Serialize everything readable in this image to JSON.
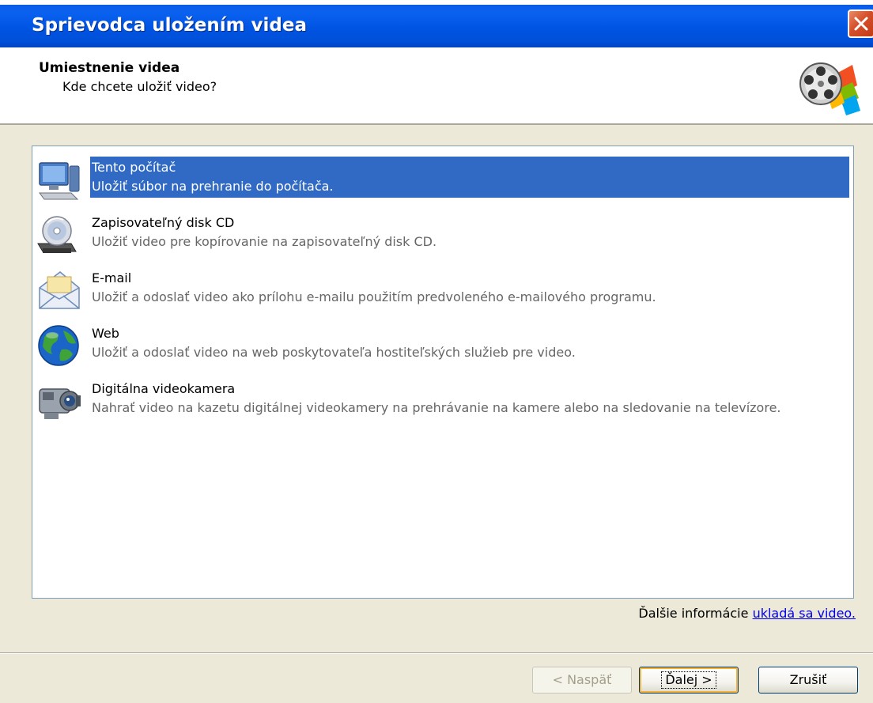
{
  "window": {
    "title": "Sprievodca uložením videa"
  },
  "header": {
    "title": "Umiestnenie videa",
    "subtitle": "Kde chcete uložiť video?"
  },
  "destinations": [
    {
      "title": "Tento počítač",
      "description": "Uložiť súbor na prehranie do počítača.",
      "icon": "computer-icon",
      "selected": true
    },
    {
      "title": "Zapisovateľný disk CD",
      "description": "Uložiť video pre kopírovanie na zapisovateľný disk CD.",
      "icon": "cd-icon",
      "selected": false
    },
    {
      "title": "E-mail",
      "description": "Uložiť a odoslať video ako prílohu e-mailu použitím predvoleného e-mailového programu.",
      "icon": "email-icon",
      "selected": false
    },
    {
      "title": "Web",
      "description": "Uložiť a odoslať video na web poskytovateľa hostiteľských služieb pre video.",
      "icon": "globe-icon",
      "selected": false
    },
    {
      "title": "Digitálna videokamera",
      "description": "Nahrať video na kazetu digitálnej videokamery na prehrávanie na kamere alebo na sledovanie na televízore.",
      "icon": "camcorder-icon",
      "selected": false
    }
  ],
  "more_info": {
    "text": "Ďalšie informácie ",
    "link": "ukladá sa video."
  },
  "buttons": {
    "back": "< Naspäť",
    "next": "Ďalej >",
    "cancel": "Zrušiť"
  },
  "colors": {
    "titlebar": "#0054e3",
    "selection": "#316ac5",
    "dialog_bg": "#ece9d8"
  }
}
